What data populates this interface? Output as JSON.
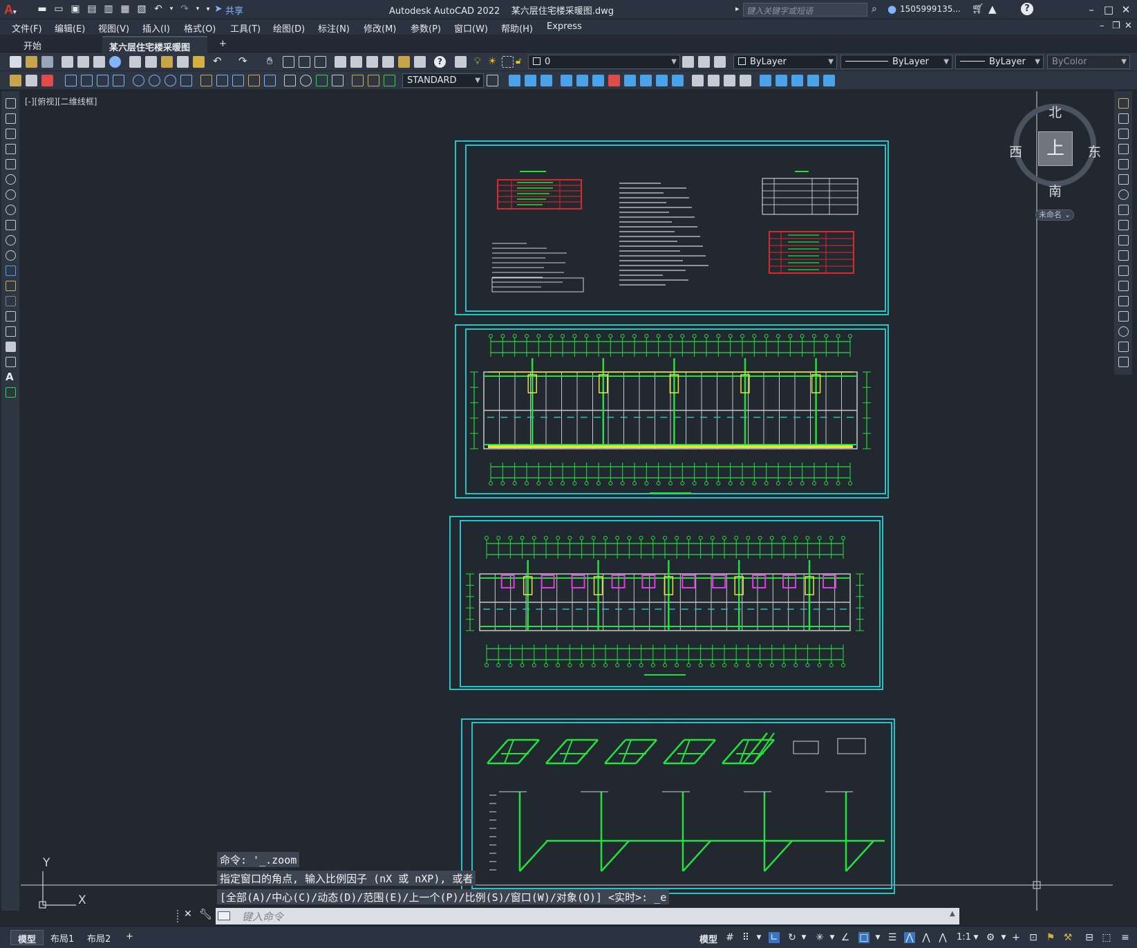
{
  "title_bar": {
    "app_title": "Autodesk AutoCAD 2022    某六层住宅楼采暖图.dwg",
    "share_label": "共享",
    "search_placeholder": "键入关键字或短语",
    "user": "1505999135..."
  },
  "menu": [
    "文件(F)",
    "编辑(E)",
    "视图(V)",
    "插入(I)",
    "格式(O)",
    "工具(T)",
    "绘图(D)",
    "标注(N)",
    "修改(M)",
    "参数(P)",
    "窗口(W)",
    "帮助(H)",
    "Express"
  ],
  "tabs": {
    "start": "开始",
    "document": "某六层住宅楼采暖图*"
  },
  "toolbar": {
    "layer_value": "0",
    "color_value": "ByLayer",
    "linetype_value": "ByLayer",
    "lineweight_value": "ByLayer",
    "plotstyle_value": "ByColor",
    "textstyle_value": "STANDARD"
  },
  "viewport_label": "[-][俯视][二维线框]",
  "viewcube": {
    "north": "北",
    "south": "南",
    "east": "东",
    "west": "西",
    "top": "上",
    "ucs": "未命名"
  },
  "ucs_axes": {
    "x": "X",
    "y": "Y"
  },
  "command_history": [
    "命令: '_.zoom",
    "指定窗口的角点, 输入比例因子 (nX 或 nXP), 或者",
    "[全部(A)/中心(C)/动态(D)/范围(E)/上一个(P)/比例(S)/窗口(W)/对象(O)] <实时>: _e"
  ],
  "command_input_placeholder": "键入命令",
  "layout_tabs": [
    "模型",
    "布局1",
    "布局2"
  ],
  "status": {
    "model_label": "模型",
    "scale": "1:1"
  },
  "colors": {
    "drawing_bg": "#212830",
    "frame": "#27c3c9",
    "pipe": "#25e03d",
    "wall": "#c8c8c8",
    "accent_red": "#e02828",
    "accent_yellow": "#e6e43a",
    "accent_magenta": "#e33be6"
  }
}
